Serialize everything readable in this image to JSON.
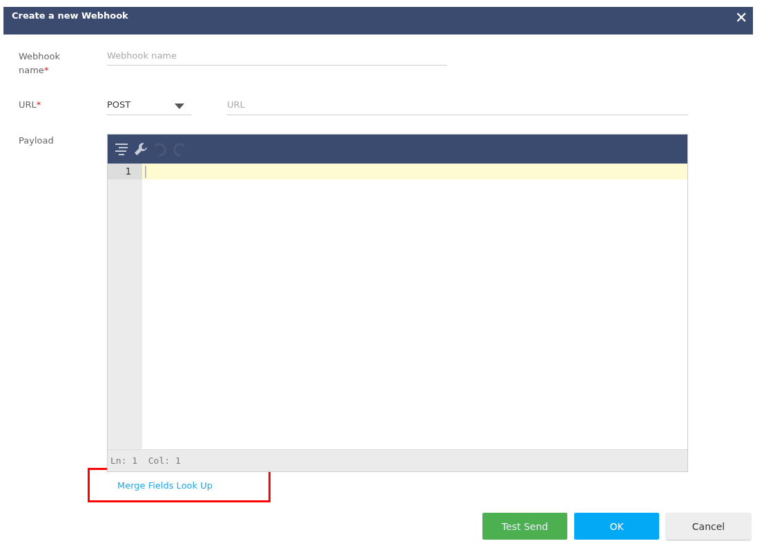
{
  "dialog": {
    "title": "Create a new Webhook",
    "close": "✕"
  },
  "fields": [
    {
      "kind": "text",
      "label": "Webhook name",
      "required_mark": "*",
      "placeholder": "Webhook name"
    },
    {
      "kind": "url",
      "label": "URL",
      "required_mark": "*",
      "method": "POST",
      "placeholder": "URL"
    },
    {
      "kind": "editor",
      "label": "Payload"
    }
  ],
  "editor": {
    "toolbar": [
      {
        "kind": "format",
        "disabled": false
      },
      {
        "kind": "settings",
        "disabled": false
      },
      {
        "kind": "undo",
        "disabled": true
      },
      {
        "kind": "redo",
        "disabled": true
      }
    ],
    "line_numbers": [
      "1"
    ],
    "status": "Ln: 1  Col: 1"
  },
  "merge_link": {
    "label": "Merge Fields Look Up",
    "highlighted": true
  },
  "buttons": [
    {
      "kind": "success",
      "label": "Test Send"
    },
    {
      "kind": "primary",
      "label": "OK"
    },
    {
      "kind": "default",
      "label": "Cancel"
    }
  ]
}
